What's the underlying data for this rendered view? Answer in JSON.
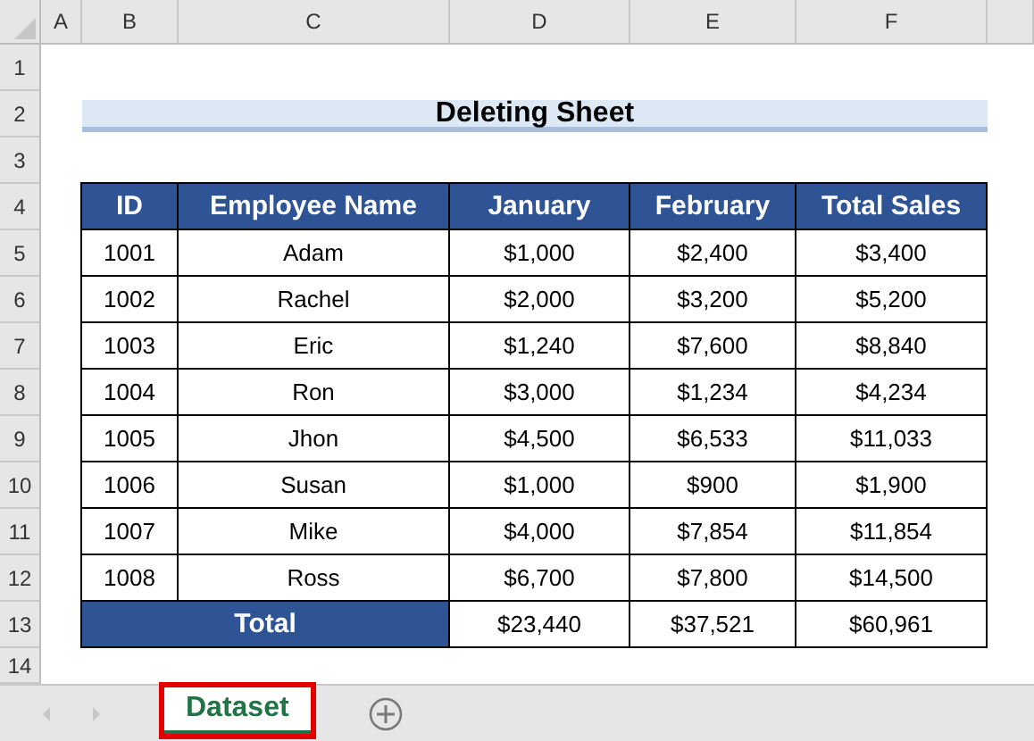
{
  "column_headers": [
    "A",
    "B",
    "C",
    "D",
    "E",
    "F"
  ],
  "row_headers": [
    "1",
    "2",
    "3",
    "4",
    "5",
    "6",
    "7",
    "8",
    "9",
    "10",
    "11",
    "12",
    "13",
    "14"
  ],
  "title": "Deleting Sheet",
  "table": {
    "columns": [
      "ID",
      "Employee Name",
      "January",
      "February",
      "Total Sales"
    ],
    "rows": [
      [
        "1001",
        "Adam",
        "$1,000",
        "$2,400",
        "$3,400"
      ],
      [
        "1002",
        "Rachel",
        "$2,000",
        "$3,200",
        "$5,200"
      ],
      [
        "1003",
        "Eric",
        "$1,240",
        "$7,600",
        "$8,840"
      ],
      [
        "1004",
        "Ron",
        "$3,000",
        "$1,234",
        "$4,234"
      ],
      [
        "1005",
        "Jhon",
        "$4,500",
        "$6,533",
        "$11,033"
      ],
      [
        "1006",
        "Susan",
        "$1,000",
        "$900",
        "$1,900"
      ],
      [
        "1007",
        "Mike",
        "$4,000",
        "$7,854",
        "$11,854"
      ],
      [
        "1008",
        "Ross",
        "$6,700",
        "$7,800",
        "$14,500"
      ]
    ],
    "total": {
      "label": "Total",
      "values": [
        "$23,440",
        "$37,521",
        "$60,961"
      ]
    }
  },
  "sheet_tabs": [
    {
      "label": "Dataset",
      "selected": true,
      "highlighted": true
    }
  ]
}
